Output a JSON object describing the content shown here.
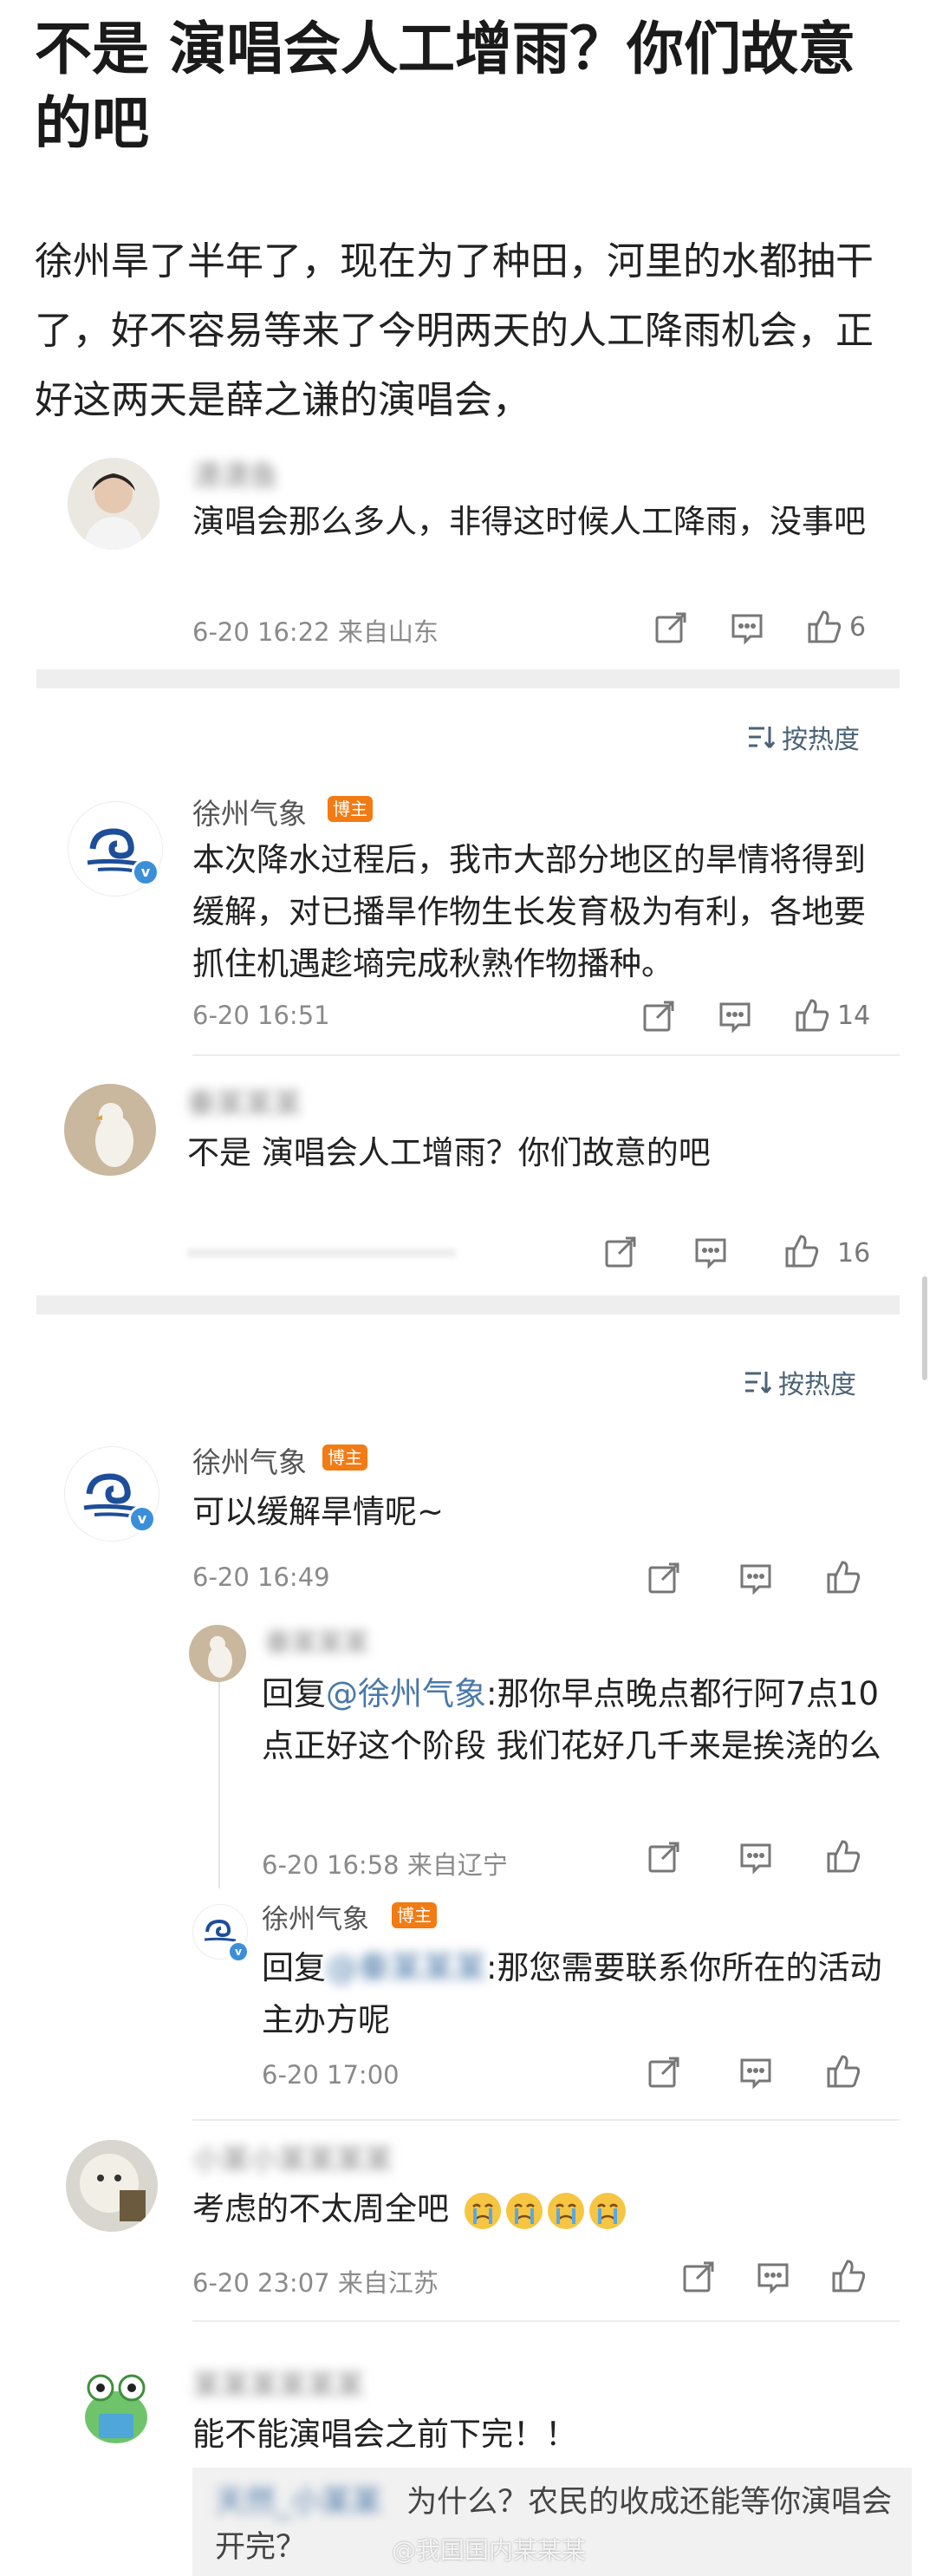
{
  "title": "不是 演唱会人工增雨？你们故意的吧",
  "intro": "徐州旱了半年了，现在为了种田，河里的水都抽干了，好不容易等来了今明两天的人工降雨机会，正好这两天是薛之谦的演唱会，",
  "c1": {
    "username": "潇潇鱼",
    "text": "演唱会那么多人，非得这时候人工降雨，没事吧",
    "meta": "6-20 16:22  来自山东",
    "likes": "6"
  },
  "sort_label": "按热度",
  "c2": {
    "username": "徐州气象",
    "badge": "博主",
    "text": "本次降水过程后，我市大部分地区的旱情将得到缓解，对已播旱作物生长发育极为有利，各地要抓住机遇趁墒完成秋熟作物播种。",
    "meta": "6-20 16:51",
    "likes": "14"
  },
  "c3": {
    "username": "秦某某某",
    "text": "不是 演唱会人工增雨？你们故意的吧",
    "likes": "16"
  },
  "c4": {
    "username": "徐州气象",
    "badge": "博主",
    "text": "可以缓解旱情呢~",
    "meta": "6-20 16:49"
  },
  "r1": {
    "username": "秦某某某",
    "reply_prefix": "回复",
    "mention": "@徐州气象",
    "text": ":那你早点晚点都行阿7点10点正好这个阶段 我们花好几千来是挨浇的么",
    "meta": "6-20 16:58  来自辽宁"
  },
  "r2": {
    "username": "徐州气象",
    "badge": "博主",
    "reply_prefix": "回复",
    "mention": "@秦某某某",
    "text": ":那您需要联系你所在的活动主办方呢",
    "meta": "6-20 17:00"
  },
  "c5": {
    "username": "小某小某某某某",
    "text": "考虑的不太周全吧",
    "meta": "6-20 23:07  来自江苏"
  },
  "c6": {
    "username": "某某某某某某",
    "text": "能不能演唱会之前下完！！",
    "quote_user": "天然_小某某",
    "quote_text": "为什么？农民的收成还能等你演唱会开完？"
  },
  "watermark": "@我国国内某某某",
  "icons": [
    "share-icon",
    "comment-icon",
    "like-icon",
    "sort-icon",
    "verified-icon",
    "crying-emoji-icon"
  ]
}
